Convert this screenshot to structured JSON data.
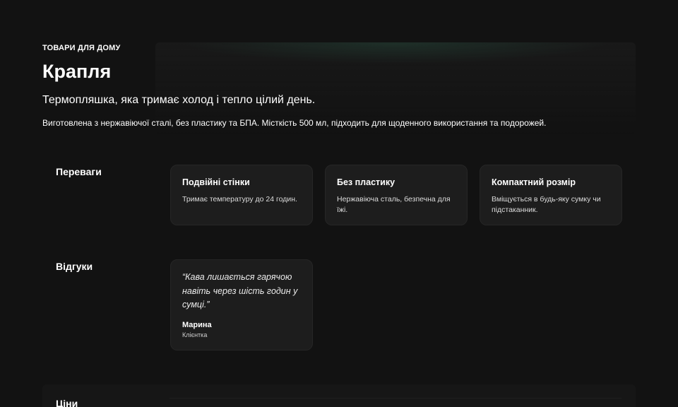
{
  "hero": {
    "eyebrow": "ТОВАРИ ДЛЯ ДОМУ",
    "title": "Крапля",
    "tagline": "Термопляшка, яка тримає холод і тепло цілий день.",
    "description": "Виготовлена з нержавіючої сталі, без пластику та БПА. Місткість 500 мл, підходить для щоденного використання та подорожей."
  },
  "benefits": {
    "label": "Переваги",
    "cards": [
      {
        "title": "Подвійні стінки",
        "text": "Тримає температуру до 24 годин."
      },
      {
        "title": "Без пластику",
        "text": "Нержавіюча сталь, безпечна для їжі."
      },
      {
        "title": "Компактний розмір",
        "text": "Вміщується в будь-яку сумку чи підстаканник."
      }
    ]
  },
  "reviews": {
    "label": "Відгуки",
    "items": [
      {
        "quote": "“Кава лишається гарячою навіть через шість годин у сумці.”",
        "author": "Марина",
        "role": "Клієнтка"
      }
    ]
  },
  "prices": {
    "label": "Ціни"
  },
  "colors": {
    "background": "#121212",
    "card": "#1d1d1d",
    "accent_glow": "#285a46"
  }
}
